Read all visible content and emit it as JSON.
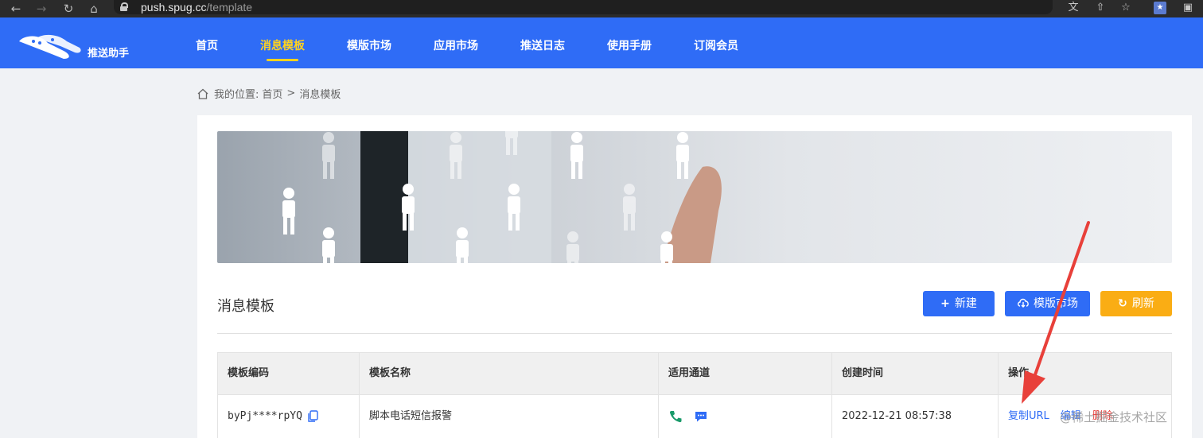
{
  "browser": {
    "url_host": "push.spug.cc",
    "url_path": "/template"
  },
  "header": {
    "brand": "推送助手",
    "nav": [
      {
        "label": "首页",
        "active": false
      },
      {
        "label": "消息模板",
        "active": true
      },
      {
        "label": "模版市场",
        "active": false
      },
      {
        "label": "应用市场",
        "active": false
      },
      {
        "label": "推送日志",
        "active": false
      },
      {
        "label": "使用手册",
        "active": false
      },
      {
        "label": "订阅会员",
        "active": false
      }
    ]
  },
  "breadcrumb": {
    "prefix": "我的位置:",
    "home": "首页",
    "separator": ">",
    "current": "消息模板"
  },
  "card": {
    "title": "消息模板",
    "buttons": {
      "new_label": "新建",
      "market_label": "模版市场",
      "refresh_label": "刷新"
    }
  },
  "table": {
    "headers": [
      "模板编码",
      "模板名称",
      "适用通道",
      "创建时间",
      "操作"
    ],
    "rows": [
      {
        "code": "byPj****rpYQ",
        "name": "脚本电话短信报警",
        "channels": [
          "phone-icon",
          "sms-icon"
        ],
        "created": "2022-12-21 08:57:38",
        "actions": [
          "复制URL",
          "编辑",
          "删除"
        ]
      }
    ]
  },
  "watermark": "@稀土掘金技术社区",
  "colors": {
    "primary": "#2f6cf6",
    "active_nav": "#ffd21f",
    "refresh": "#faad14",
    "danger": "#e53935",
    "channel_phone": "#1a9a6a",
    "channel_sms": "#2f6cf6"
  }
}
